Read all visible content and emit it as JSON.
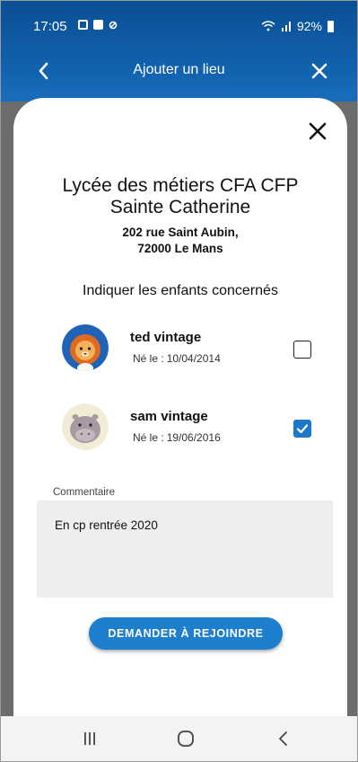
{
  "status_bar": {
    "time": "17:05",
    "battery": "92%",
    "notification_icons": [
      "message-icon",
      "image-icon",
      "link-icon"
    ]
  },
  "header": {
    "title": "Ajouter un lieu",
    "back_icon": "chevron-left-icon",
    "close_icon": "close-icon"
  },
  "sheet": {
    "close_icon": "close-icon",
    "place_name_line1": "Lycée des métiers CFA CFP",
    "place_name_line2": "Sainte Catherine",
    "address_line1": "202 rue Saint Aubin,",
    "address_line2": "72000 Le Mans",
    "children_title": "Indiquer les enfants concernés",
    "dob_prefix": "Né le :",
    "children": [
      {
        "name": "ted vintage",
        "dob": "10/04/2014",
        "checked": false,
        "avatar": "lion-avatar"
      },
      {
        "name": "sam vintage",
        "dob": "19/06/2016",
        "checked": true,
        "avatar": "hippo-avatar"
      }
    ],
    "comment_label": "Commentaire",
    "comment_value": "En cp rentrée 2020",
    "join_button": "DEMANDER À REJOINDRE"
  },
  "nav_bar": {
    "items": [
      "recent-apps-icon",
      "home-icon",
      "back-icon"
    ]
  },
  "colors": {
    "header_blue": "#1262ae",
    "accent": "#1f7fcf",
    "sheet_bg": "#ffffff",
    "comment_bg": "#eeeeee"
  }
}
